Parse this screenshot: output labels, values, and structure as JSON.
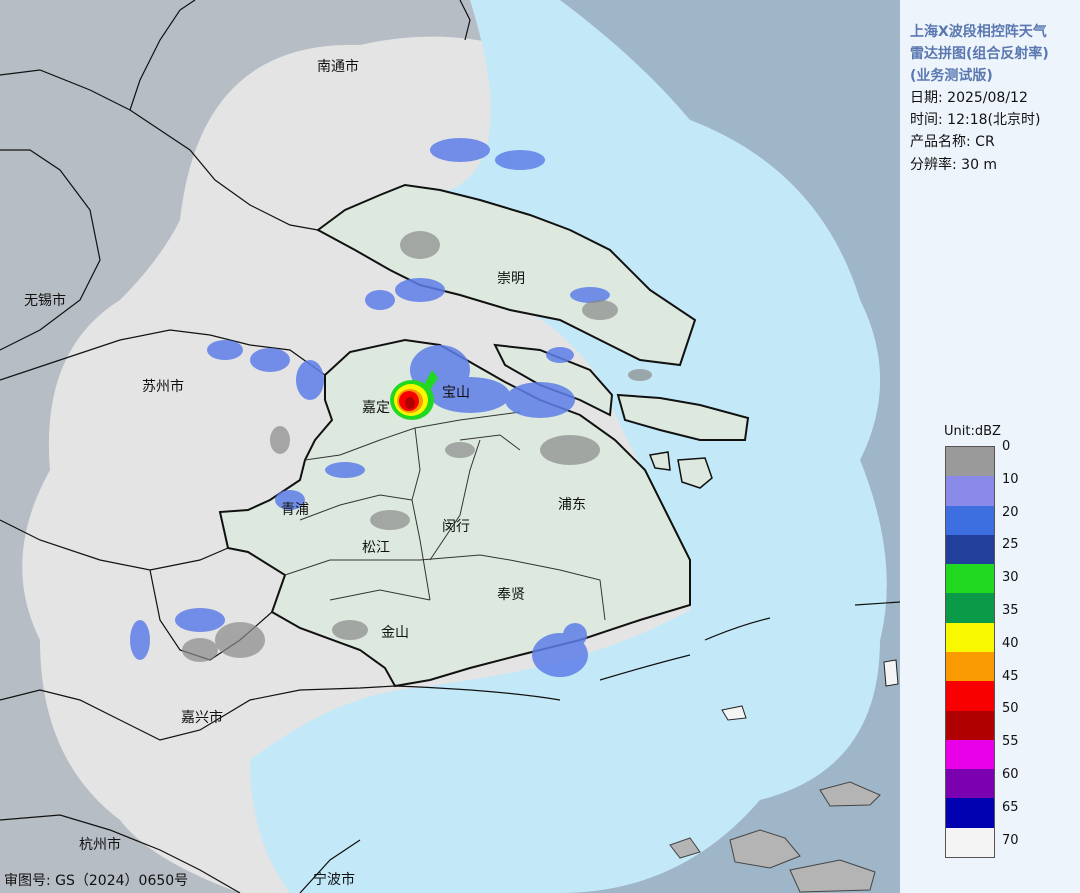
{
  "panel": {
    "title_lines": [
      "上海X波段相控阵天气",
      "雷达拼图(组合反射率)",
      "(业务测试版)"
    ],
    "date": "日期: 2025/08/12",
    "time": "时间: 12:18(北京时)",
    "product": "产品名称: CR",
    "resolution": "分辨率: 30 m"
  },
  "legend": {
    "unit": "Unit:dBZ",
    "ticks": [
      "0",
      "10",
      "20",
      "25",
      "30",
      "35",
      "40",
      "45",
      "50",
      "55",
      "60",
      "65",
      "70"
    ],
    "colors": [
      "#9a9a9a",
      "#8a8ae8",
      "#3d6fe0",
      "#223f9c",
      "#1fd81f",
      "#0a9a48",
      "#f8f800",
      "#f89a00",
      "#f80000",
      "#b00000",
      "#e800e8",
      "#7a00b0",
      "#0000b0",
      "#f4f4f4"
    ]
  },
  "map": {
    "cities": {
      "nantong": "南通市",
      "wuxi": "无锡市",
      "suzhou": "苏州市",
      "jiaxing": "嘉兴市",
      "hangzhou": "杭州市",
      "ningbo": "宁波市"
    },
    "districts": {
      "chongming": "崇明",
      "jiading": "嘉定",
      "baoshan": "宝山",
      "qingpu": "青浦",
      "songjiang": "松江",
      "minhang": "闵行",
      "pudong": "浦东",
      "fengxian": "奉贤",
      "jinshan": "金山"
    },
    "colors": {
      "sea": "#c3e8f8",
      "land": "#e4e4e4",
      "outside": "#b7bdc4",
      "shanghai": "#dde9de"
    }
  },
  "footer": {
    "review_number": "审图号: GS（2024）0650号"
  }
}
